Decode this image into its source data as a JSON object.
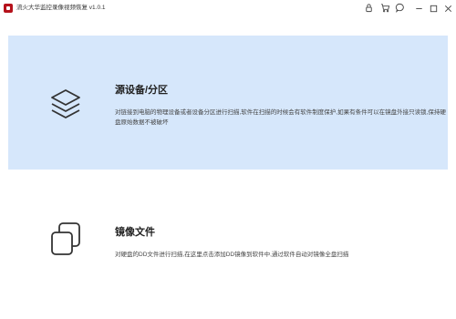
{
  "window": {
    "title": "流火大华监控录像视频恢复 v1.0.1",
    "logo_color": "#b5121b"
  },
  "toolbar": {
    "icons": [
      "lock-icon",
      "cart-icon",
      "chat-icon",
      "minimize-icon",
      "maximize-icon",
      "close-icon"
    ]
  },
  "cards": [
    {
      "title": "源设备/分区",
      "description": "对链接到电脑的物理设备或者设备分区进行扫描,软件在扫描的时候会有软件制度保护,如果有条件可以在镜盘外接只读锁,保持硬盘原始数据不被破坏",
      "icon": "layers-icon",
      "background": "#d6e7fb"
    },
    {
      "title": "镜像文件",
      "description": "对硬盘的DD文件进行扫描,在这里点击添加DD镜像到软件中,通过软件自动对镜像全盘扫描",
      "icon": "copy-icon",
      "background": "#ffffff"
    }
  ]
}
